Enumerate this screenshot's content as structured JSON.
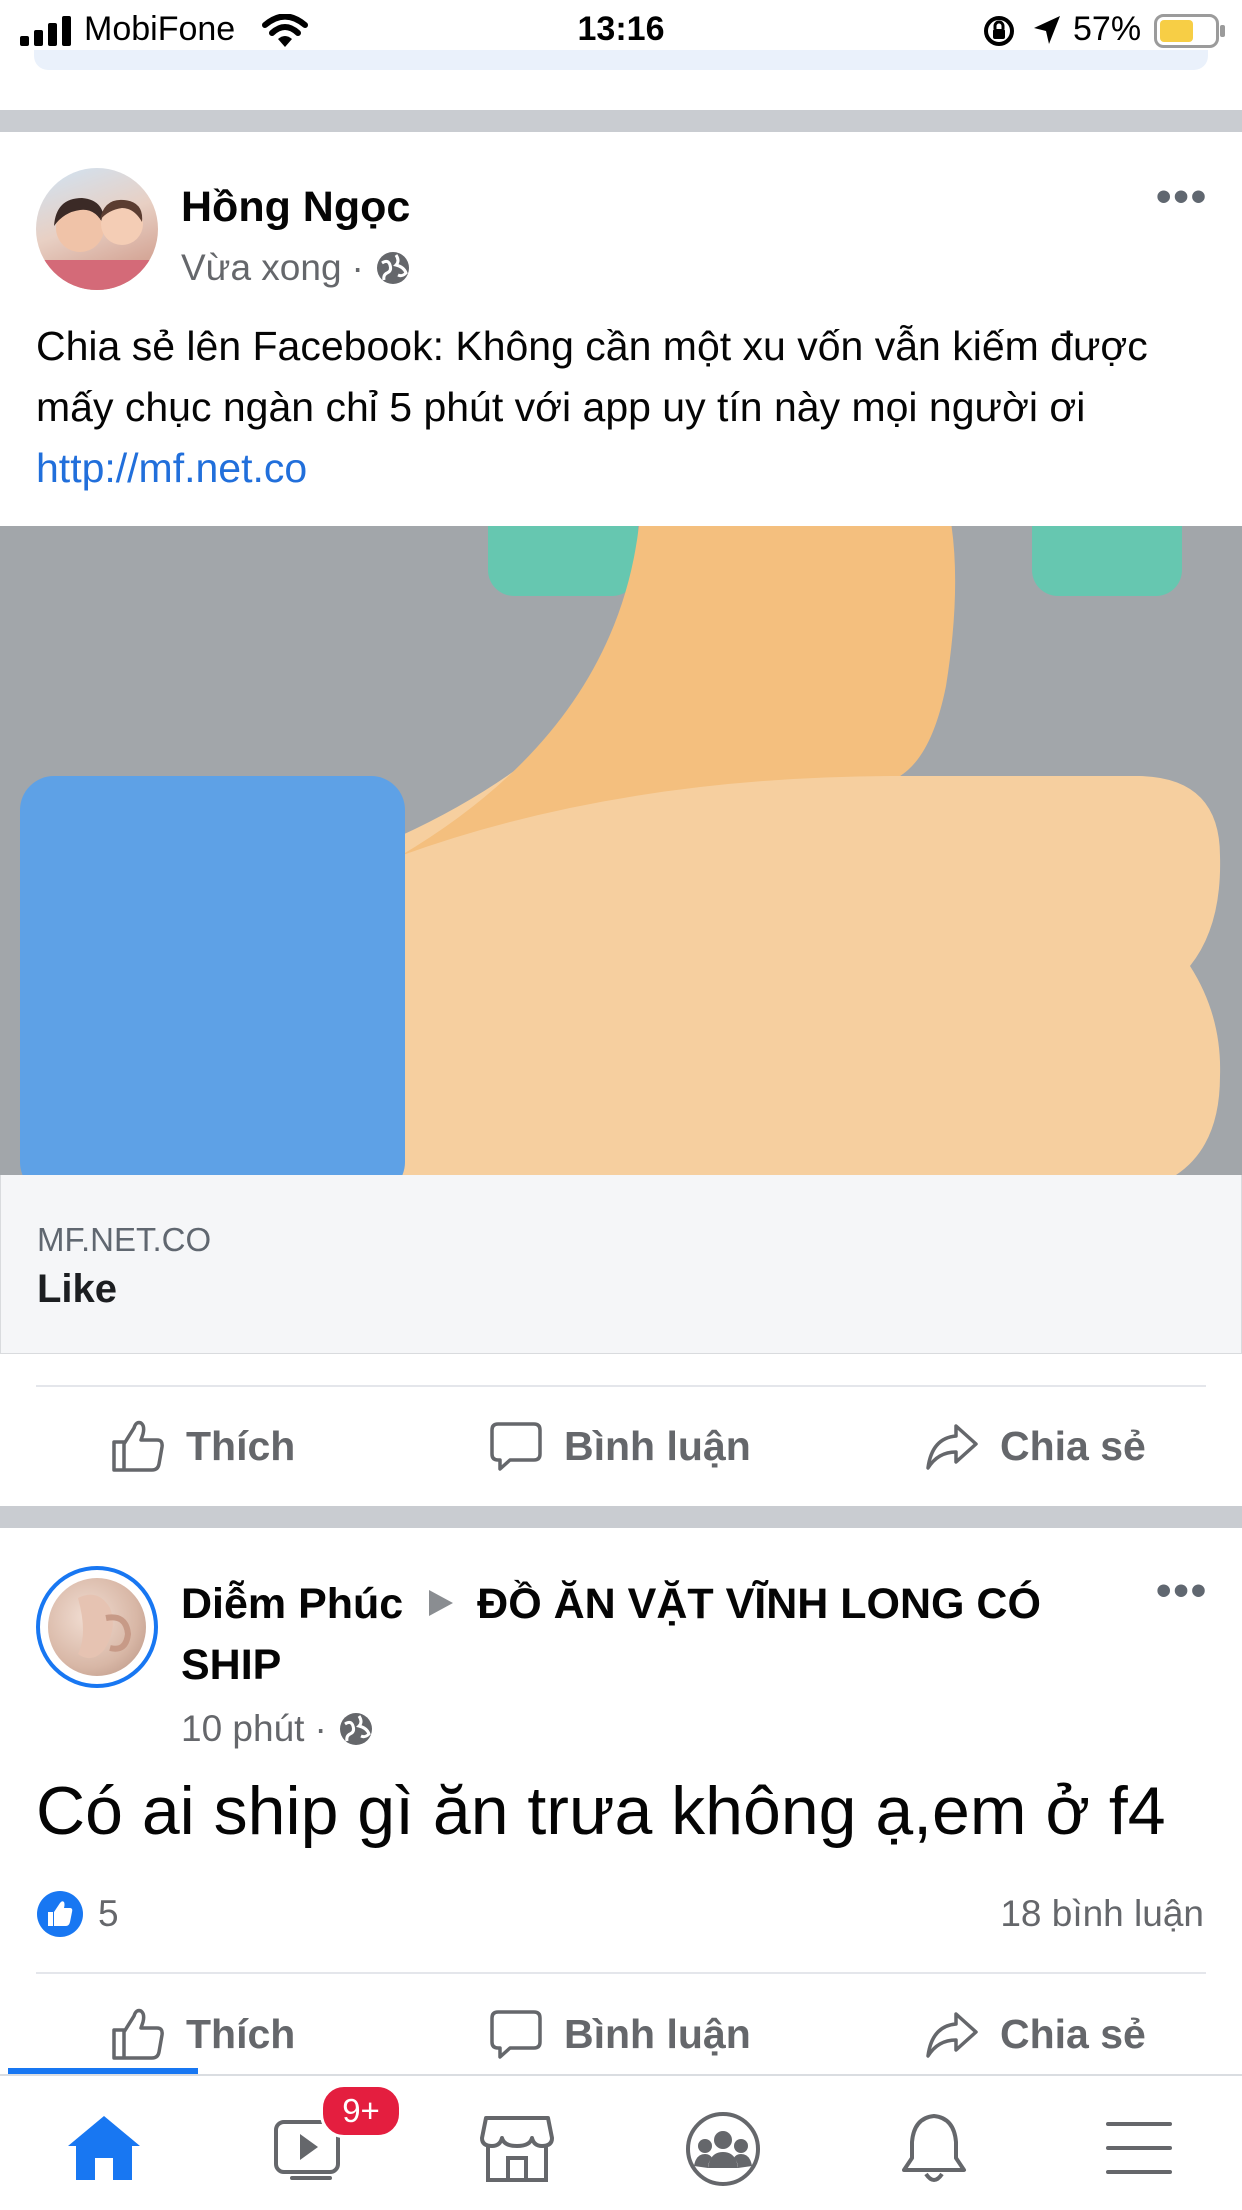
{
  "status_bar": {
    "carrier": "MobiFone",
    "time": "13:16",
    "battery": "57%"
  },
  "post1": {
    "author": "Hồng Ngọc",
    "time": "Vừa xong",
    "text_prefix": "Chia sẻ lên Facebook: Không cần một xu vốn vẫn kiếm được mấy chục ngàn chỉ 5 phút với app uy tín này mọi người ơi ",
    "link": "http://mf.net.co",
    "preview_domain": "MF.NET.CO",
    "preview_title": "Like",
    "actions": {
      "like": "Thích",
      "comment": "Bình luận",
      "share": "Chia sẻ"
    }
  },
  "post2": {
    "author": "Diễm Phúc",
    "group": "ĐỒ ĂN VẶT VĨNH LONG CÓ SHIP",
    "time": "10 phút",
    "text": "Có ai ship gì ăn trưa không ạ,em ở f4",
    "reaction_count": "5",
    "comment_count": "18 bình luận",
    "actions": {
      "like": "Thích",
      "comment": "Bình luận",
      "share": "Chia sẻ"
    }
  },
  "tabbar": {
    "watch_badge": "9+"
  },
  "colors": {
    "accent": "#1877f2",
    "link": "#216fdb",
    "separator": "#c9ccd1",
    "thumb_light": "#f6cf9f",
    "thumb_dark": "#f4bf7e",
    "cuff": "#5ea1e6",
    "preview_bg": "#a2a6aa"
  }
}
